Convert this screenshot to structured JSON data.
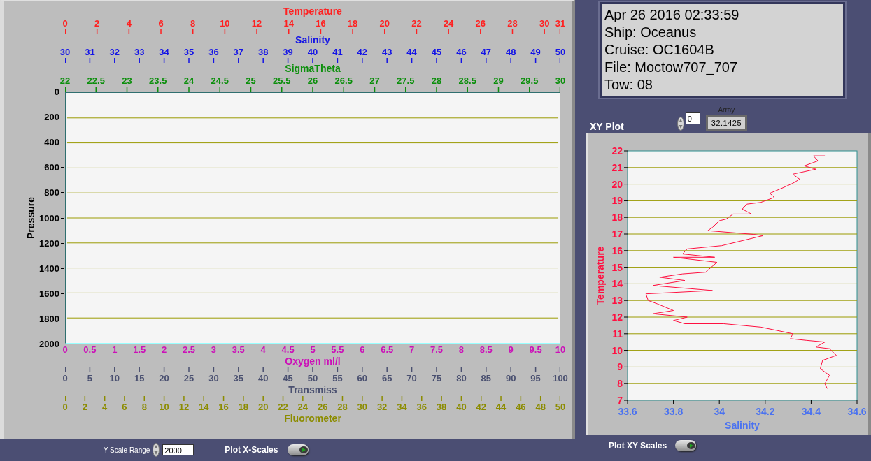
{
  "profile_graph": {
    "top_scales": [
      {
        "label": "Temperature",
        "color": "#ff2020",
        "ticks": [
          "0",
          "2",
          "4",
          "6",
          "8",
          "10",
          "12",
          "14",
          "16",
          "18",
          "20",
          "22",
          "24",
          "26",
          "28",
          "30",
          "31"
        ]
      },
      {
        "label": "Salinity",
        "color": "#1414e6",
        "ticks": [
          "30",
          "31",
          "32",
          "33",
          "34",
          "35",
          "36",
          "37",
          "38",
          "39",
          "40",
          "41",
          "42",
          "43",
          "44",
          "45",
          "46",
          "47",
          "48",
          "49",
          "50"
        ]
      },
      {
        "label": "SigmaTheta",
        "color": "#0c8f0c",
        "ticks": [
          "22",
          "22.5",
          "23",
          "23.5",
          "24",
          "24.5",
          "25",
          "25.5",
          "26",
          "26.5",
          "27",
          "27.5",
          "28",
          "28.5",
          "29",
          "29.5",
          "30"
        ]
      }
    ],
    "y_axis": {
      "label": "Pressure",
      "ticks": [
        "0",
        "200",
        "400",
        "600",
        "800",
        "1000",
        "1200",
        "1400",
        "1600",
        "1800",
        "2000"
      ]
    },
    "bottom_scales": [
      {
        "label": "Oxygen ml/l",
        "color": "#cc10b8",
        "ticks": [
          "0",
          "0.5",
          "1",
          "1.5",
          "2",
          "2.5",
          "3",
          "3.5",
          "4",
          "4.5",
          "5",
          "5.5",
          "6",
          "6.5",
          "7",
          "7.5",
          "8",
          "8.5",
          "9",
          "9.5",
          "10"
        ]
      },
      {
        "label": "Transmiss",
        "color": "#4a5070",
        "ticks": [
          "0",
          "5",
          "10",
          "15",
          "20",
          "25",
          "30",
          "35",
          "40",
          "45",
          "50",
          "55",
          "60",
          "65",
          "70",
          "75",
          "80",
          "85",
          "90",
          "95",
          "100"
        ]
      },
      {
        "label": "Fluorometer",
        "color": "#8c8c00",
        "ticks": [
          "0",
          "2",
          "4",
          "6",
          "8",
          "10",
          "12",
          "14",
          "16",
          "18",
          "20",
          "22",
          "24",
          "26",
          "28",
          "30",
          "32",
          "34",
          "36",
          "38",
          "40",
          "42",
          "44",
          "46",
          "48",
          "50"
        ]
      }
    ]
  },
  "bottom_bar": {
    "y_scale_range": {
      "label": "Y-Scale Range",
      "value": "2000"
    },
    "plot_x_scales": {
      "label": "Plot X-Scales",
      "on": true
    }
  },
  "info_box": {
    "lines": [
      "Apr 26 2016 02:33:59",
      "Ship: Oceanus",
      "Cruise: OC1604B",
      "File: Moctow707_707",
      "Tow: 08"
    ]
  },
  "array": {
    "label": "Array",
    "index": "0",
    "value": "32.1425"
  },
  "xy_plot": {
    "title": "XY Plot",
    "chart_data": {
      "type": "line",
      "grid": true,
      "xlabel": "Salinity",
      "ylabel": "Temperature",
      "xlim": [
        33.6,
        34.6
      ],
      "ylim": [
        7,
        22
      ],
      "xticks": [
        33.6,
        33.8,
        34,
        34.2,
        34.4,
        34.6
      ],
      "yticks": [
        7,
        8,
        9,
        10,
        11,
        12,
        13,
        14,
        15,
        16,
        17,
        18,
        19,
        20,
        21,
        22
      ],
      "x": [
        34.46,
        34.41,
        34.43,
        34.37,
        34.42,
        34.32,
        34.35,
        34.32,
        34.28,
        34.22,
        34.24,
        34.18,
        34.12,
        34.1,
        34.14,
        34.06,
        34.03,
        34.0,
        33.97,
        33.95,
        34.15,
        34.19,
        34.01,
        33.86,
        33.84,
        33.98,
        33.8,
        33.99,
        33.94,
        33.84,
        33.74,
        33.85,
        33.71,
        33.97,
        33.68,
        33.69,
        33.73,
        33.8,
        33.71,
        33.86,
        33.8,
        33.85,
        34.02,
        34.18,
        34.25,
        34.32,
        34.31,
        34.38,
        34.46,
        34.42,
        34.48,
        34.51,
        34.45,
        34.44,
        34.48,
        34.46,
        34.47
      ],
      "series": [
        {
          "color": "#ff1040",
          "values": [
            21.7,
            21.7,
            21.4,
            21.1,
            20.9,
            20.6,
            20.3,
            20.05,
            19.8,
            19.45,
            19.2,
            18.9,
            18.8,
            18.5,
            18.2,
            18.2,
            17.9,
            17.8,
            17.4,
            17.2,
            16.98,
            16.9,
            16.3,
            16.1,
            15.8,
            15.6,
            15.6,
            15.3,
            14.7,
            14.6,
            14.4,
            14.2,
            13.9,
            13.6,
            13.4,
            13.0,
            12.8,
            12.4,
            12.2,
            12.0,
            11.8,
            11.6,
            11.6,
            11.4,
            11.2,
            11.0,
            10.7,
            10.6,
            10.5,
            10.2,
            10.1,
            9.7,
            9.4,
            8.9,
            8.5,
            8.0,
            7.7
          ]
        }
      ]
    }
  },
  "xy_controls": {
    "plot_xy_scales": {
      "label": "Plot XY Scales",
      "on": true
    }
  }
}
